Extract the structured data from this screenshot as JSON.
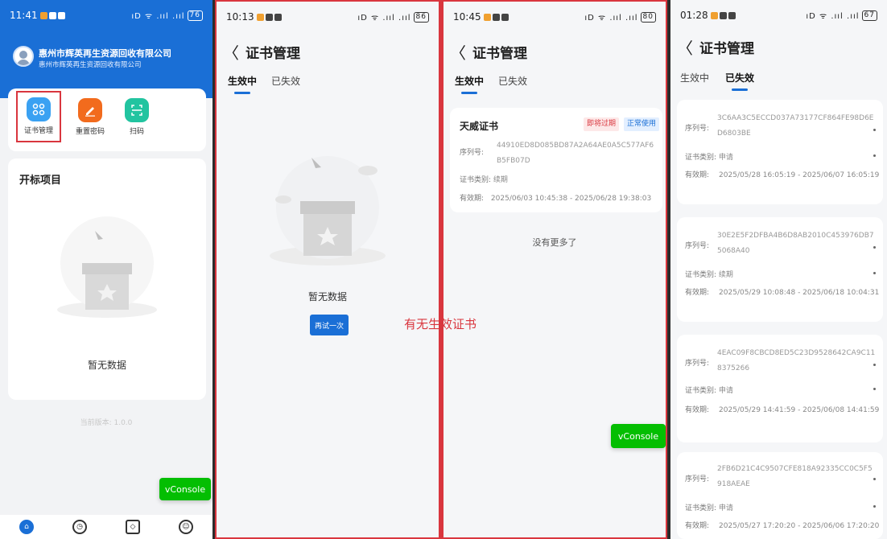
{
  "caption": "有无生效证书",
  "phone1": {
    "time": "11:41",
    "signal": "ıD ᯤ .ııl .ııl",
    "battery": "76",
    "company_name": "惠州市辉英再生资源回收有限公司",
    "company_sub": "惠州市辉英再生资源回收有限公司",
    "menu": [
      {
        "label": "证书管理",
        "icon": "grid-icon"
      },
      {
        "label": "重置密码",
        "icon": "pencil-icon"
      },
      {
        "label": "扫码",
        "icon": "scan-icon"
      }
    ],
    "bid_title": "开标项目",
    "empty_text": "暂无数据",
    "version": "当前版本: 1.0.0",
    "vconsole": "vConsole"
  },
  "phone2": {
    "time": "10:13",
    "signal": "ıD ᯤ .ııl .ııl",
    "battery": "86",
    "back": "〈",
    "title": "证书管理",
    "tab_active": "生效中",
    "tab_inactive": "已失效",
    "empty_text": "暂无数据",
    "retry": "再试一次"
  },
  "phone3": {
    "time": "10:45",
    "signal": "ıD ᯤ .ııl .ııl",
    "battery": "80",
    "back": "〈",
    "title": "证书管理",
    "tab_active": "生效中",
    "tab_inactive": "已失效",
    "cert": {
      "name": "天威证书",
      "badge_warn": "即将过期",
      "badge_ok": "正常使用",
      "serial_label": "序列号:",
      "serial": "44910ED8D085BD87A2A64AE0A5C577AF6B5FB07D",
      "type_label": "证书类别:",
      "type": "续期",
      "valid_label": "有效期:",
      "valid": "2025/06/03 10:45:38 - 2025/06/28 19:38:03"
    },
    "no_more": "没有更多了",
    "vconsole": "vConsole"
  },
  "phone4": {
    "time": "01:28",
    "signal": "ıD ᯤ .ııl .ııl",
    "battery": "67",
    "back": "〈",
    "title": "证书管理",
    "tab_inactive": "生效中",
    "tab_active": "已失效",
    "serial_label": "序列号:",
    "type_label": "证书类别:",
    "valid_label": "有效期:",
    "certs": [
      {
        "serial": "3C6AA3C5ECCD037A73177CF864FE98D6ED6803BE",
        "type": "申请",
        "valid": "2025/05/28 16:05:19 - 2025/06/07 16:05:19"
      },
      {
        "serial": "30E2E5F2DFBA4B6D8AB2010C453976DB75068A40",
        "type": "续期",
        "valid": "2025/05/29 10:08:48 - 2025/06/18 10:04:31"
      },
      {
        "serial": "4EAC09F8CBCD8ED5C23D9528642CA9C118375266",
        "type": "申请",
        "valid": "2025/05/29 14:41:59 - 2025/06/08 14:41:59"
      },
      {
        "serial": "2FB6D21C4C9507CFE818A92335CC0C5F5918AEAE",
        "type": "申请",
        "valid": "2025/05/27 17:20:20 - 2025/06/06 17:20:20"
      }
    ]
  }
}
